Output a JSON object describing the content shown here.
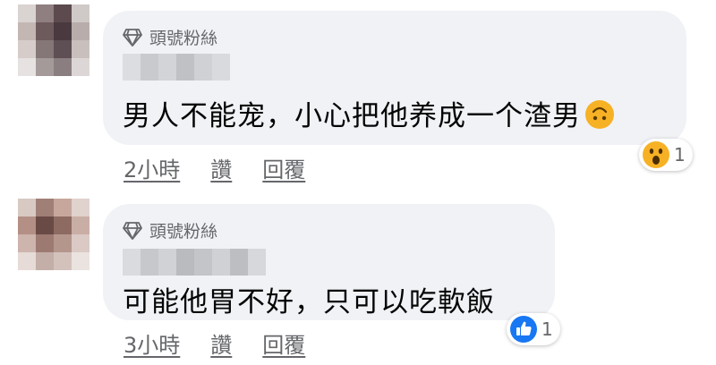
{
  "comments": [
    {
      "badge": "頭號粉絲",
      "text": "男人不能宠，小心把他养成一个渣男",
      "time": "2小時",
      "like": "讚",
      "reply": "回覆",
      "reaction": {
        "icon": "wow-emoji-icon",
        "count": "1"
      }
    },
    {
      "badge": "頭號粉絲",
      "text": "可能他胃不好，只可以吃軟飯",
      "time": "3小時",
      "like": "讚",
      "reply": "回覆",
      "reaction": {
        "icon": "like-thumb-icon",
        "count": "1"
      }
    }
  ],
  "colors": {
    "bubble": "#f0f2f5",
    "secondary_text": "#65676b",
    "like_blue": "#1877f2",
    "emoji_yellow": "#f7b125"
  }
}
